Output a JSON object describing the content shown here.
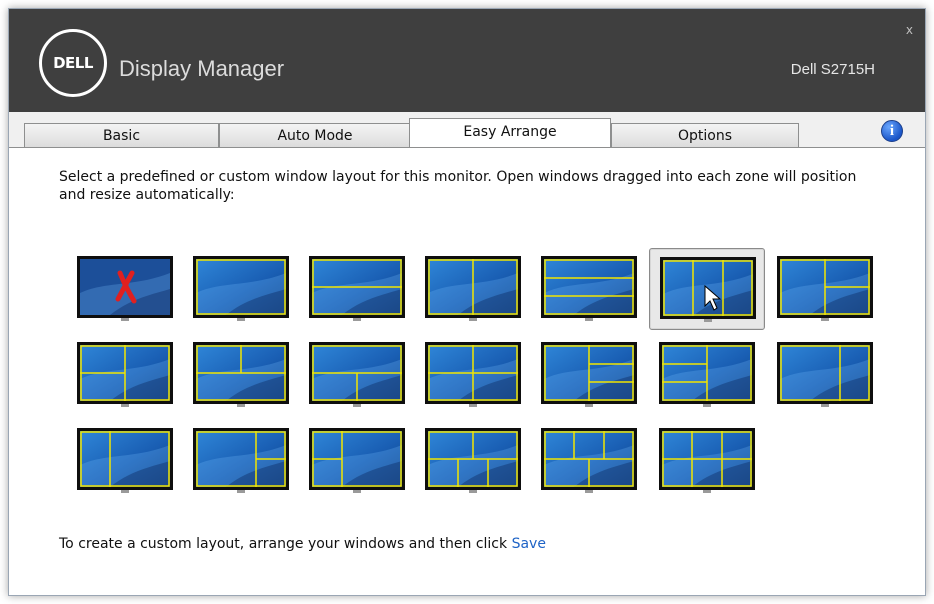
{
  "window": {
    "brand_logo": "DELL",
    "app_title": "Display Manager",
    "monitor_name": "Dell S2715H",
    "close_label": "x"
  },
  "tabs": [
    {
      "label": "Basic",
      "active": false
    },
    {
      "label": "Auto Mode",
      "active": false
    },
    {
      "label": "Easy Arrange",
      "active": true
    },
    {
      "label": "Options",
      "active": false
    }
  ],
  "info_icon": "info-icon",
  "content": {
    "description": "Select a predefined or custom window layout for this monitor. Open windows dragged into each zone will position and resize automatically:",
    "footer_text": "To create a custom layout, arrange your windows and then click ",
    "save_link": "Save"
  },
  "layouts": [
    {
      "id": "off",
      "selected": false
    },
    {
      "id": "full",
      "selected": false
    },
    {
      "id": "two-rows",
      "selected": false
    },
    {
      "id": "two-cols",
      "selected": false
    },
    {
      "id": "three-rows",
      "selected": false
    },
    {
      "id": "three-cols",
      "selected": true
    },
    {
      "id": "left-plus-right-two",
      "selected": false
    },
    {
      "id": "left-two-plus-right",
      "selected": false
    },
    {
      "id": "top-two-bottom-one",
      "selected": false
    },
    {
      "id": "top-one-bottom-two",
      "selected": false
    },
    {
      "id": "quad",
      "selected": false
    },
    {
      "id": "left-plus-right-three",
      "selected": false
    },
    {
      "id": "left-three-plus-right",
      "selected": false
    },
    {
      "id": "wide-right",
      "selected": false
    },
    {
      "id": "wide-left",
      "selected": false
    },
    {
      "id": "right-two-mix",
      "selected": false
    },
    {
      "id": "left-two-mix",
      "selected": false
    },
    {
      "id": "top-two-bottom-three",
      "selected": false
    },
    {
      "id": "top-three-bottom-two",
      "selected": false
    },
    {
      "id": "six-grid",
      "selected": false
    }
  ],
  "colors": {
    "titlebar": "#3f3f3f",
    "zone_line": "#f2e600",
    "screen_blue": "#1a63b8",
    "link": "#1e63c6"
  }
}
